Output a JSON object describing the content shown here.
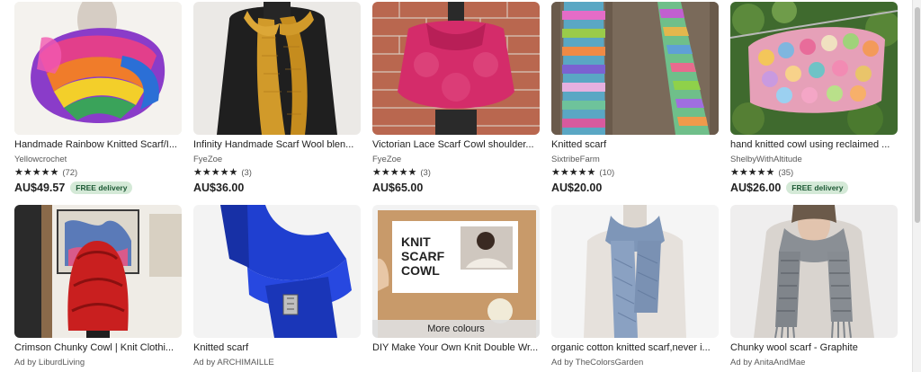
{
  "listings_row1": [
    {
      "title": "Handmade Rainbow Knitted Scarf/I...",
      "shop": "Yellowcrochet",
      "stars": "★★★★★",
      "count": "(72)",
      "price": "AU$49.57",
      "badge": "FREE delivery",
      "image_icon": "rainbow-infinity-scarf-photo"
    },
    {
      "title": "Infinity Handmade Scarf Wool blen...",
      "shop": "FyeZoe",
      "stars": "★★★★★",
      "count": "(3)",
      "price": "AU$36.00",
      "badge": "",
      "image_icon": "mustard-scarf-photo"
    },
    {
      "title": "Victorian Lace Scarf Cowl shoulder...",
      "shop": "FyeZoe",
      "stars": "★★★★★",
      "count": "(3)",
      "price": "AU$65.00",
      "badge": "",
      "image_icon": "pink-lace-cowl-photo"
    },
    {
      "title": "Knitted scarf",
      "shop": "SixtribeFarm",
      "stars": "★★★★★",
      "count": "(10)",
      "price": "AU$20.00",
      "badge": "",
      "image_icon": "striped-scarf-photo"
    },
    {
      "title": "hand knitted cowl using reclaimed ...",
      "shop": "ShelbyWithAltitude",
      "stars": "★★★★★",
      "count": "(35)",
      "price": "AU$26.00",
      "badge": "FREE delivery",
      "image_icon": "chunky-cowl-photo"
    }
  ],
  "listings_row2": [
    {
      "title": "Crimson Chunky Cowl | Knit Clothi...",
      "shop": "Ad by LiburdLiving",
      "more": "",
      "image_icon": "red-cowl-photo"
    },
    {
      "title": "Knitted scarf",
      "shop": "Ad by ARCHIMAILLE",
      "more": "",
      "image_icon": "blue-scarf-photo"
    },
    {
      "title": "DIY Make Your Own Knit Double Wr...",
      "shop": "",
      "more": "More colours",
      "kit_line1": "KNIT",
      "kit_line2": "SCARF",
      "kit_line3": "COWL",
      "image_icon": "knit-kit-photo"
    },
    {
      "title": "organic cotton knitted scarf,never i...",
      "shop": "Ad by TheColorsGarden",
      "more": "",
      "image_icon": "grey-blue-scarf-photo"
    },
    {
      "title": "Chunky wool scarf - Graphite",
      "shop": "Ad by AnitaAndMae",
      "more": "",
      "image_icon": "graphite-scarf-photo"
    }
  ]
}
